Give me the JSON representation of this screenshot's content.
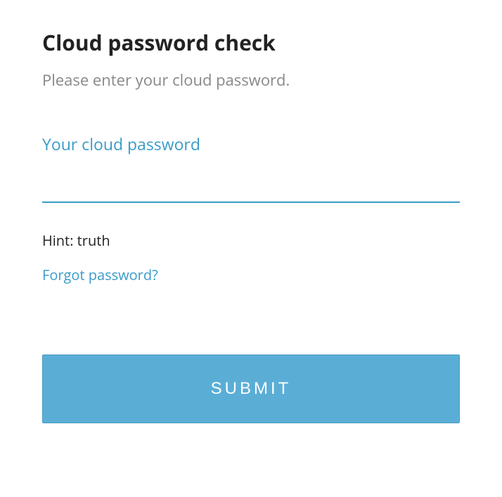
{
  "form": {
    "title": "Cloud password check",
    "subtitle": "Please enter your cloud password.",
    "password_label": "Your cloud password",
    "password_value": "",
    "hint_prefix": "Hint: ",
    "hint_value": "truth",
    "forgot_link": "Forgot password?",
    "submit_label": "SUBMIT"
  },
  "colors": {
    "accent": "#3a9bc8",
    "button_bg": "#5aaed6",
    "text_dark": "#222222",
    "text_muted": "#888888"
  }
}
